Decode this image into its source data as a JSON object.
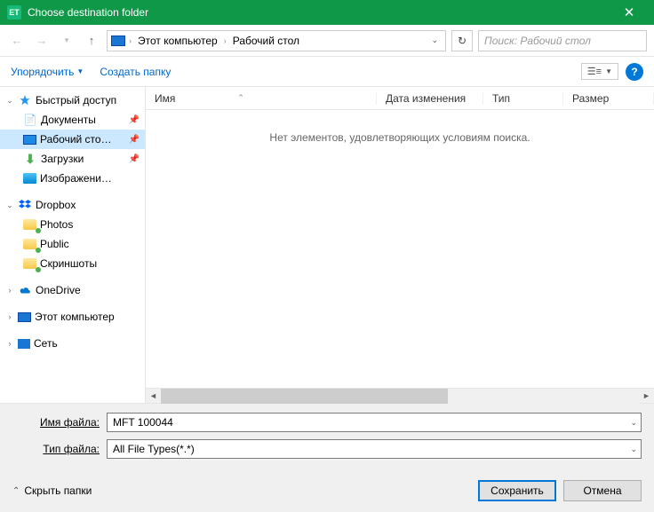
{
  "window": {
    "title": "Choose destination folder"
  },
  "breadcrumb": {
    "pc": "Этот компьютер",
    "desktop": "Рабочий стол"
  },
  "search": {
    "placeholder": "Поиск: Рабочий стол"
  },
  "toolbar": {
    "organize": "Упорядочить",
    "newfolder": "Создать папку"
  },
  "columns": {
    "name": "Имя",
    "date": "Дата изменения",
    "type": "Тип",
    "size": "Размер"
  },
  "empty": "Нет элементов, удовлетворяющих условиям поиска.",
  "sidebar": {
    "quick": "Быстрый доступ",
    "documents": "Документы",
    "desktop": "Рабочий сто…",
    "downloads": "Загрузки",
    "pictures": "Изображени…",
    "dropbox": "Dropbox",
    "photos": "Photos",
    "public": "Public",
    "screenshots": "Скриншоты",
    "onedrive": "OneDrive",
    "thispc": "Этот компьютер",
    "network": "Сеть"
  },
  "form": {
    "filename_label": "Имя файла:",
    "filename_value": "MFT 100044",
    "filetype_label": "Тип файла:",
    "filetype_value": "All File Types(*.*)"
  },
  "footer": {
    "hide": "Скрыть папки",
    "save": "Сохранить",
    "cancel": "Отмена"
  }
}
